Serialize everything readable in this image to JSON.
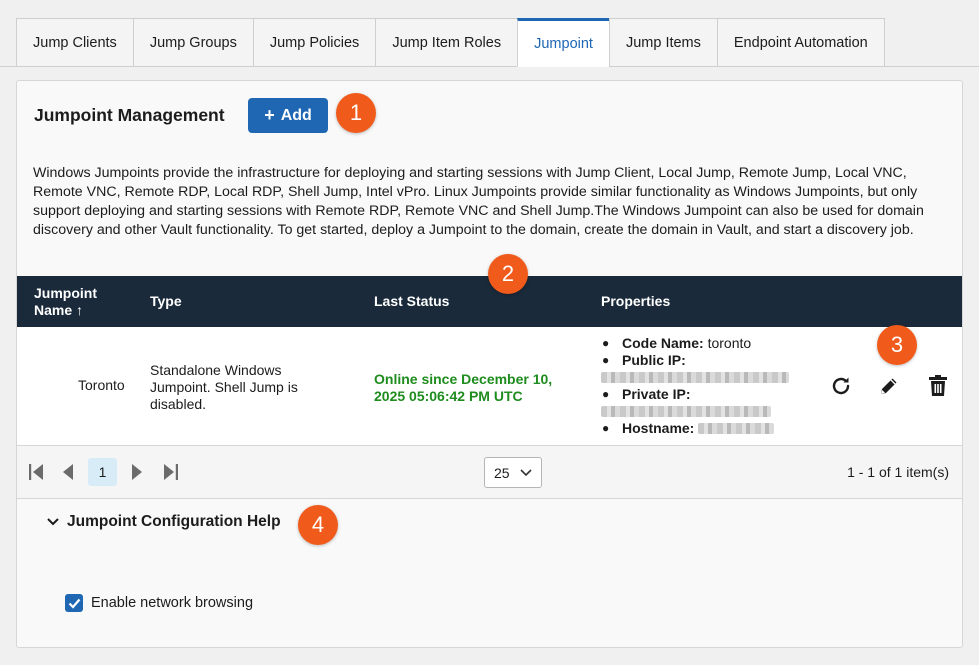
{
  "tabs": [
    {
      "label": "Jump Clients",
      "active": false
    },
    {
      "label": "Jump Groups",
      "active": false
    },
    {
      "label": "Jump Policies",
      "active": false
    },
    {
      "label": "Jump Item Roles",
      "active": false
    },
    {
      "label": "Jumpoint",
      "active": true
    },
    {
      "label": "Jump Items",
      "active": false
    },
    {
      "label": "Endpoint Automation",
      "active": false
    }
  ],
  "panel": {
    "title": "Jumpoint Management",
    "add_label": "Add",
    "description": "Windows Jumpoints provide the infrastructure for deploying and starting sessions with Jump Client, Local Jump, Remote Jump, Local VNC, Remote VNC, Remote RDP, Local RDP, Shell Jump, Intel vPro.    Linux Jumpoints provide similar functionality as Windows Jumpoints, but only support deploying and starting sessions with Remote RDP, Remote VNC and Shell Jump.The Windows Jumpoint can also be used for domain discovery and other Vault functionality. To get started, deploy a Jumpoint to the domain, create the domain in Vault, and start a discovery job."
  },
  "table": {
    "headers": {
      "name_line1": "Jumpoint",
      "name_line2": "Name ↑",
      "type": "Type",
      "last_status": "Last Status",
      "properties": "Properties"
    },
    "rows": [
      {
        "name": "Toronto",
        "type": "Standalone Windows Jumpoint. Shell Jump is disabled.",
        "status": "Online since December 10, 2025 05:06:42 PM UTC",
        "props": {
          "code_name_label": "Code Name:",
          "code_name_value": "toronto",
          "public_ip_label": "Public IP:",
          "private_ip_label": "Private IP:",
          "hostname_label": "Hostname:"
        }
      }
    ]
  },
  "pager": {
    "current_page": "1",
    "page_size": "25",
    "item_count": "1 - 1 of 1 item(s)"
  },
  "help": {
    "title": "Jumpoint Configuration Help"
  },
  "network_browsing": {
    "label": "Enable network browsing",
    "checked": true
  },
  "callouts": [
    "1",
    "2",
    "3",
    "4"
  ],
  "colors": {
    "accent": "#1f66b3",
    "header_bg": "#1a2a3a",
    "status_online": "#1e8c1e",
    "callout": "#f05a1a"
  },
  "icons": [
    "plus-icon",
    "refresh-icon",
    "edit-icon",
    "delete-icon",
    "first-page-icon",
    "prev-page-icon",
    "next-page-icon",
    "last-page-icon",
    "chevron-down-icon",
    "checkmark-icon"
  ]
}
